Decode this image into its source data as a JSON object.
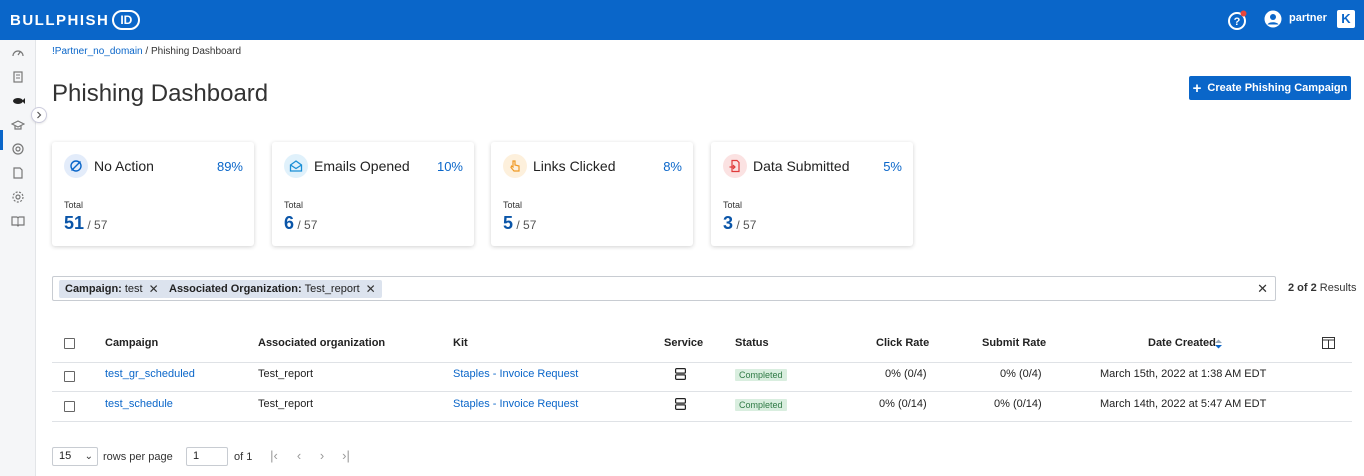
{
  "app": {
    "logo_text": "BULLPHISH",
    "logo_badge": "ID",
    "user": "partner",
    "brand_letter": "K"
  },
  "breadcrumb": {
    "parent": "!Partner_no_domain",
    "separator": " / ",
    "current": "Phishing Dashboard"
  },
  "page": {
    "title": "Phishing Dashboard",
    "create_button": "Create Phishing Campaign"
  },
  "cards": [
    {
      "label": "No Action",
      "pct": "89%",
      "total_label": "Total",
      "count": "51",
      "of": "/ 57",
      "icon": "no-action-icon",
      "color": "#0a66c9"
    },
    {
      "label": "Emails Opened",
      "pct": "10%",
      "total_label": "Total",
      "count": "6",
      "of": "/ 57",
      "icon": "email-opened-icon",
      "color": "#1a8fd6"
    },
    {
      "label": "Links Clicked",
      "pct": "8%",
      "total_label": "Total",
      "count": "5",
      "of": "/ 57",
      "icon": "pointer-hand-icon",
      "color": "#f09a24"
    },
    {
      "label": "Data Submitted",
      "pct": "5%",
      "total_label": "Total",
      "count": "3",
      "of": "/ 57",
      "icon": "data-submitted-icon",
      "color": "#e03b3b"
    }
  ],
  "filters": {
    "chips": [
      {
        "key": "Campaign:",
        "value": "test"
      },
      {
        "key": "Associated Organization:",
        "value": "Test_report"
      }
    ],
    "results_bold": "2 of 2",
    "results_suffix": "Results"
  },
  "table": {
    "columns": [
      "Campaign",
      "Associated organization",
      "Kit",
      "Service",
      "Status",
      "Click Rate",
      "Submit Rate",
      "Date Created"
    ],
    "rows": [
      {
        "campaign": "test_gr_scheduled",
        "org": "Test_report",
        "kit": "Staples - Invoice Request",
        "status": "Completed",
        "click_rate": "0% (0/4)",
        "submit_rate": "0% (0/4)",
        "date": "March 15th, 2022 at 1:38 AM EDT"
      },
      {
        "campaign": "test_schedule",
        "org": "Test_report",
        "kit": "Staples - Invoice Request",
        "status": "Completed",
        "click_rate": "0% (0/14)",
        "submit_rate": "0% (0/14)",
        "date": "March 14th, 2022 at 5:47 AM EDT"
      }
    ]
  },
  "pagination": {
    "rows_per_page_value": "15",
    "rows_per_page_label": "rows per page",
    "page_value": "1",
    "of_label": "of 1"
  },
  "colors": {
    "brand_blue": "#0a66c9",
    "completed_bg": "#d9eedf",
    "completed_text": "#2f7a45"
  }
}
